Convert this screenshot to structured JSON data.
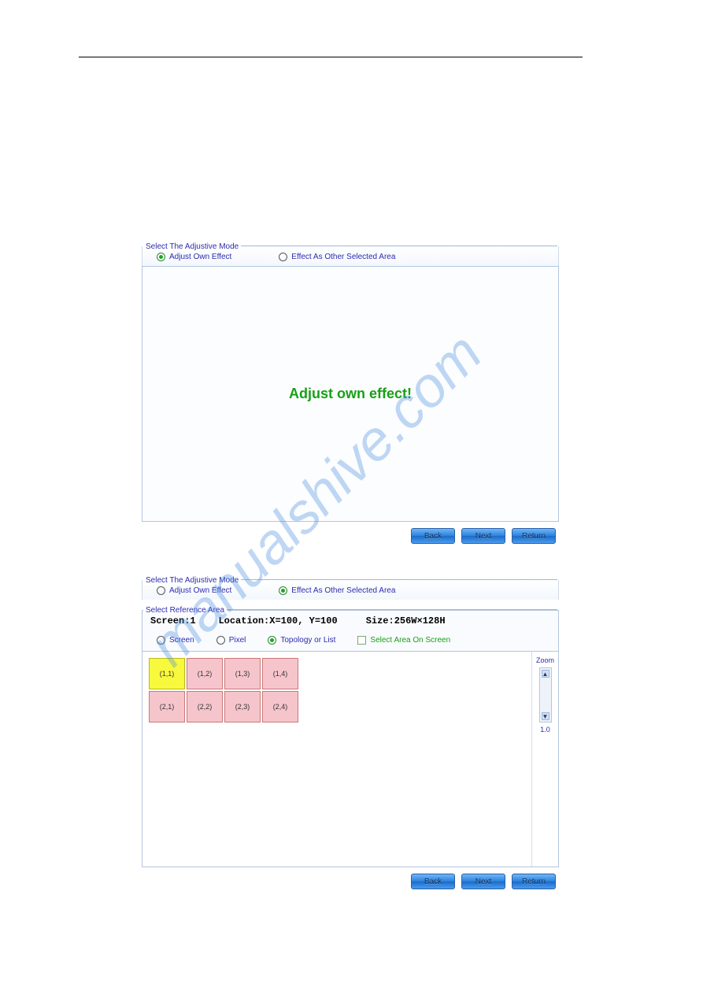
{
  "watermark_text": "manualshive.com",
  "panel_top": {
    "group_title": "Select The Adjustive Mode",
    "radio_own": "Adjust Own Effect",
    "radio_other": "Effect As Other Selected Area",
    "selected": "own",
    "message": "Adjust own effect!",
    "buttons": {
      "back": "Back",
      "next": "Next",
      "return": "Return"
    }
  },
  "panel_bottom": {
    "group_title_mode": "Select The Adjustive Mode",
    "radio_own": "Adjust Own Effect",
    "radio_other": "Effect As Other Selected Area",
    "selected": "other",
    "group_title_ref": "Select Reference Area",
    "info_screen_label": "Screen:",
    "info_screen_value": "1",
    "info_location_label": "Location:",
    "info_location_value": "X=100, Y=100",
    "info_size_label": "Size:",
    "info_size_value": "256W×128H",
    "sel_screen": "Screen",
    "sel_pixel": "Pixel",
    "sel_topology": "Topology or List",
    "chk_select_area": "Select Area On Screen",
    "grid": {
      "cols": 4,
      "rows": 2,
      "cells": [
        [
          "(1,1)",
          "(1,2)",
          "(1,3)",
          "(1,4)"
        ],
        [
          "(2,1)",
          "(2,2)",
          "(2,3)",
          "(2,4)"
        ]
      ],
      "selected": [
        0,
        0
      ]
    },
    "zoom_label": "Zoom",
    "zoom_value": "1.0",
    "buttons": {
      "back": "Back",
      "next": "Next",
      "return": "Return"
    }
  }
}
